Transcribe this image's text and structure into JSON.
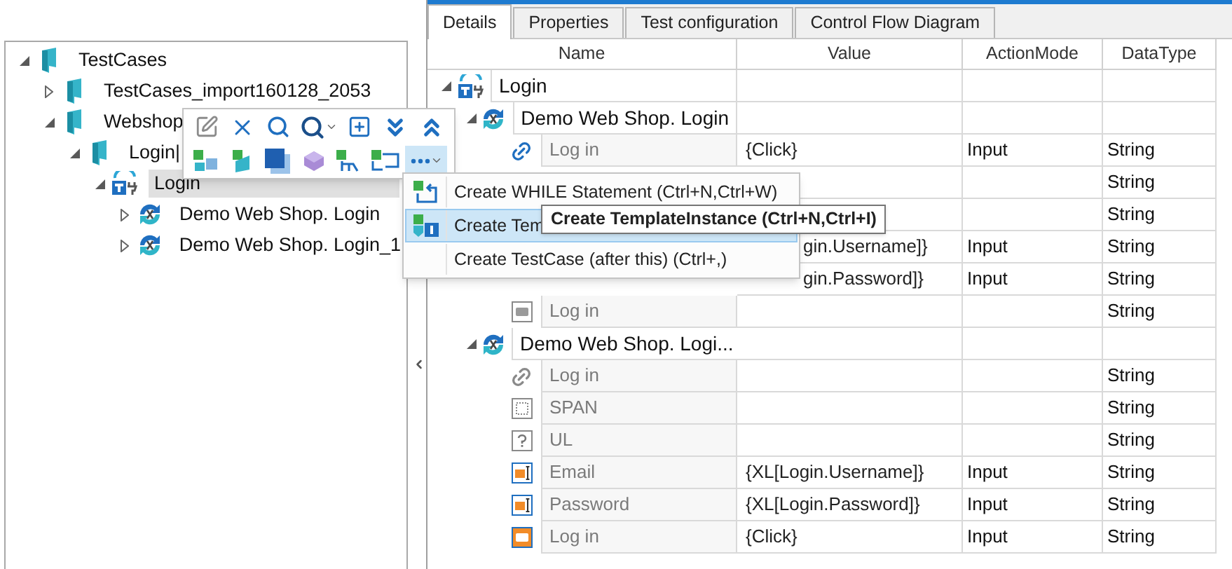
{
  "tree": [
    {
      "label": "TestCases",
      "kind": "folder",
      "expanded": true,
      "selected": false,
      "children": [
        {
          "label": "TestCases_import160128_2053",
          "kind": "folder",
          "expanded": false,
          "selected": false
        },
        {
          "label": "Webshop",
          "kind": "folder",
          "expanded": true,
          "selected": false,
          "children": [
            {
              "label": "Login|",
              "kind": "folder",
              "expanded": true,
              "selected": false,
              "children": [
                {
                  "label": "Login",
                  "kind": "testcase",
                  "expanded": true,
                  "selected": true,
                  "children": [
                    {
                      "label": "Demo Web Shop. Login",
                      "kind": "module",
                      "expanded": false,
                      "selected": false
                    },
                    {
                      "label": "Demo Web Shop. Login_1",
                      "kind": "module",
                      "expanded": false,
                      "selected": false
                    }
                  ]
                }
              ]
            }
          ]
        }
      ]
    }
  ],
  "tabs": [
    {
      "label": "Details",
      "selected": true
    },
    {
      "label": "Properties",
      "selected": false
    },
    {
      "label": "Test configuration",
      "selected": false
    },
    {
      "label": "Control Flow Diagram",
      "selected": false
    }
  ],
  "grid": {
    "columns": [
      "Name",
      "Value",
      "ActionMode",
      "DataType"
    ],
    "rows": [
      {
        "name": "Login",
        "kind": "testcase",
        "expanded": true,
        "children": [
          {
            "name": "Demo Web Shop. Login",
            "kind": "module",
            "expanded": true,
            "children": [
              {
                "name": "Log in",
                "kind": "link",
                "value": "{Click}",
                "action_mode": "Input",
                "data_type": "String"
              },
              {
                "kind": "hidden",
                "data_type": "String"
              },
              {
                "kind": "hidden",
                "data_type": "String"
              },
              {
                "kind": "hidden",
                "value": "gin.Username]}",
                "action_mode": "Input",
                "data_type": "String"
              },
              {
                "kind": "hidden",
                "value": "gin.Password]}",
                "action_mode": "Input",
                "data_type": "String"
              },
              {
                "name": "Log in",
                "kind": "button",
                "data_type": "String"
              }
            ]
          },
          {
            "name": "Demo Web Shop. Logi...",
            "kind": "module",
            "expanded": true,
            "children": [
              {
                "name": "Log in",
                "kind": "link",
                "data_type": "String"
              },
              {
                "name": "SPAN",
                "kind": "span",
                "data_type": "String"
              },
              {
                "name": "UL",
                "kind": "unknown",
                "data_type": "String"
              },
              {
                "name": "Email",
                "kind": "textbox",
                "value": "{XL[Login.Username]}",
                "action_mode": "Input",
                "data_type": "String"
              },
              {
                "name": "Password",
                "kind": "textbox",
                "value": "{XL[Login.Password]}",
                "action_mode": "Input",
                "data_type": "String"
              },
              {
                "name": "Log in",
                "kind": "button",
                "value": "{Click}",
                "action_mode": "Input",
                "data_type": "String"
              }
            ]
          }
        ]
      }
    ]
  },
  "menu": {
    "items": [
      {
        "label": "Create WHILE Statement (Ctrl+N,Ctrl+W)",
        "kind": "while",
        "selected": false
      },
      {
        "label": "Create Tem",
        "kind": "template",
        "selected": true
      },
      {
        "label": "Create TestCase (after this) (Ctrl+,)",
        "kind": "plain",
        "selected": false
      }
    ]
  },
  "tooltip": "Create TemplateInstance (Ctrl+N,Ctrl+I)"
}
